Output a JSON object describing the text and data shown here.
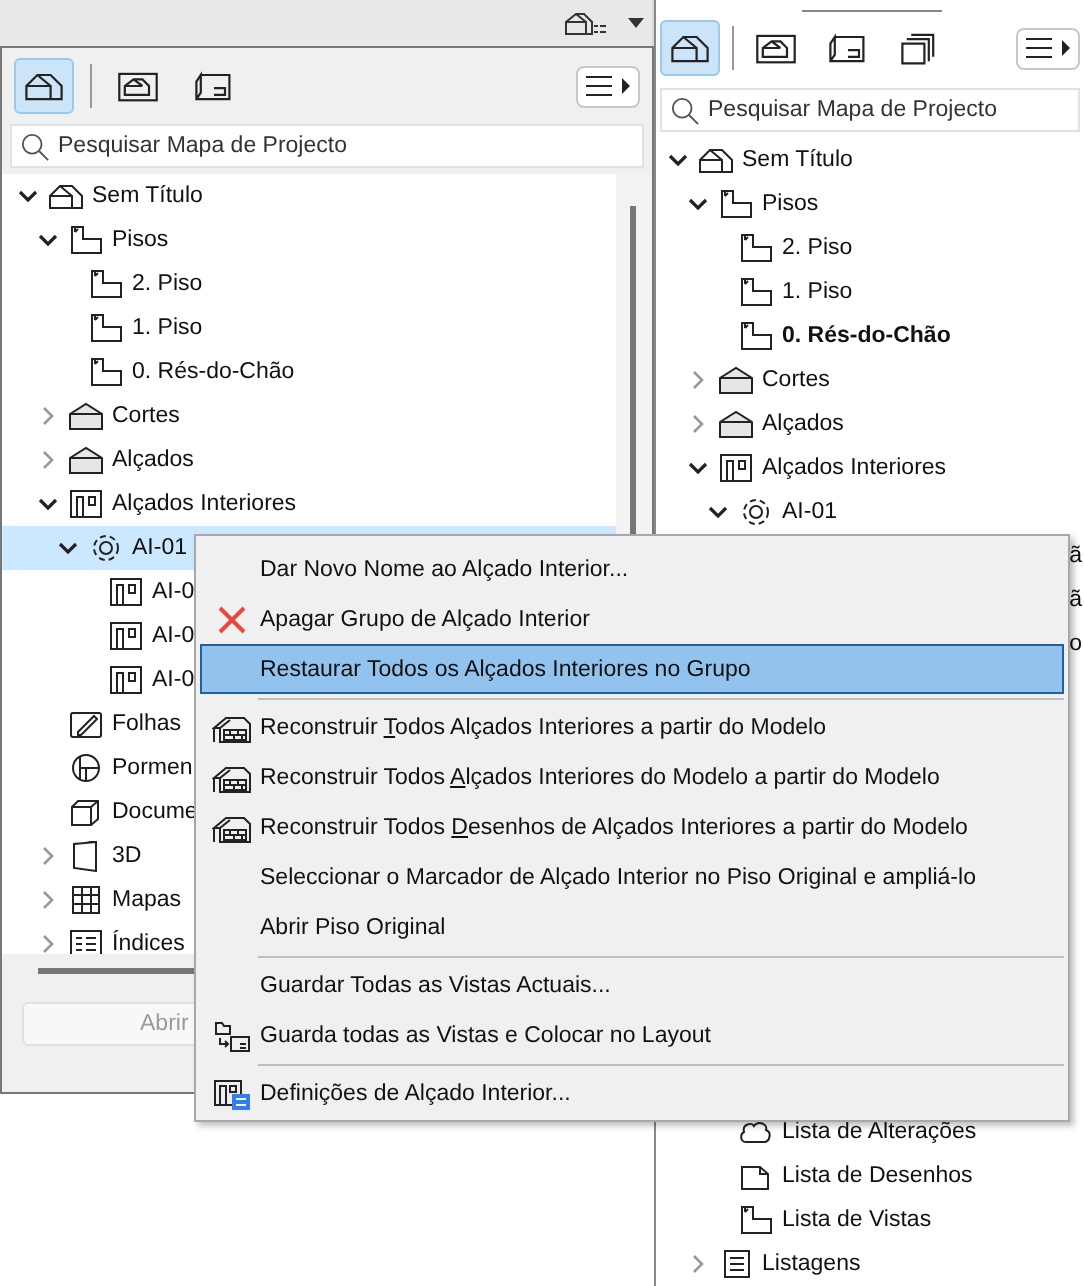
{
  "left_panel": {
    "view_tabs": [
      {
        "selected": true
      },
      {
        "selected": false
      },
      {
        "selected": false
      }
    ],
    "search": {
      "placeholder": "Pesquisar Mapa de Projecto"
    },
    "tree": [
      {
        "label": "Sem Título",
        "kind": "project",
        "expanded": true,
        "selected": false,
        "children": [
          {
            "label": "Pisos",
            "kind": "floor",
            "expanded": true,
            "selected": false,
            "children": [
              {
                "label": "2. Piso",
                "kind": "floor",
                "selected": false,
                "current": false
              },
              {
                "label": "1. Piso",
                "kind": "floor",
                "selected": false,
                "current": false
              },
              {
                "label": "0. Rés-do-Chão",
                "kind": "floor",
                "selected": false,
                "current": false
              }
            ]
          },
          {
            "label": "Cortes",
            "kind": "section",
            "expanded": false,
            "selected": false
          },
          {
            "label": "Alçados",
            "kind": "section",
            "expanded": false,
            "selected": false
          },
          {
            "label": "Alçados Interiores",
            "kind": "interior",
            "expanded": true,
            "selected": false,
            "children": [
              {
                "label": "AI-01",
                "kind": "marker",
                "expanded": true,
                "selected": true,
                "children": [
                  {
                    "label": "AI-0",
                    "kind": "interior",
                    "selected": false
                  },
                  {
                    "label": "AI-0",
                    "kind": "interior",
                    "selected": false
                  },
                  {
                    "label": "AI-0",
                    "kind": "interior",
                    "selected": false
                  }
                ]
              }
            ]
          },
          {
            "label": "Folhas",
            "kind": "worksheet",
            "selected": false
          },
          {
            "label": "Pormen",
            "kind": "detail",
            "selected": false
          },
          {
            "label": "Docume",
            "kind": "document",
            "selected": false
          },
          {
            "label": "3D",
            "kind": "model",
            "expanded": false,
            "selected": false
          },
          {
            "label": "Mapas",
            "kind": "schedule",
            "expanded": false,
            "selected": false
          },
          {
            "label": "Índices",
            "kind": "index",
            "expanded": false,
            "selected": false
          }
        ]
      }
    ],
    "open_button": {
      "label": "Abrir",
      "disabled": true
    }
  },
  "right_panel": {
    "view_tabs": [
      {
        "selected": true
      },
      {
        "selected": false
      },
      {
        "selected": false
      },
      {
        "selected": false
      }
    ],
    "search": {
      "placeholder": "Pesquisar Mapa de Projecto"
    },
    "tree": [
      {
        "label": "Sem Título",
        "kind": "project",
        "expanded": true,
        "selected": false,
        "children": [
          {
            "label": "Pisos",
            "kind": "floor",
            "expanded": true,
            "selected": false,
            "children": [
              {
                "label": "2. Piso",
                "kind": "floor",
                "selected": false,
                "current": false
              },
              {
                "label": "1. Piso",
                "kind": "floor",
                "selected": false,
                "current": false
              },
              {
                "label": "0. Rés-do-Chão",
                "kind": "floor",
                "selected": false,
                "current": true
              }
            ]
          },
          {
            "label": "Cortes",
            "kind": "section",
            "expanded": false,
            "selected": false
          },
          {
            "label": "Alçados",
            "kind": "section",
            "expanded": false,
            "selected": false
          },
          {
            "label": "Alçados Interiores",
            "kind": "interior",
            "expanded": true,
            "selected": false,
            "children": [
              {
                "label": "AI-01",
                "kind": "marker",
                "expanded": true,
                "selected": false,
                "children": [
                  {
                    "kind": "clipped",
                    "label": "ã",
                    "selected": false
                  },
                  {
                    "kind": "clipped",
                    "label": "ã",
                    "selected": false
                  },
                  {
                    "kind": "clipped",
                    "label": "o",
                    "selected": false
                  }
                ]
              }
            ]
          }
        ]
      }
    ],
    "tree_tail": [
      {
        "children": [
          {
            "label": "Lista de Alterações",
            "kind": "changes",
            "selected": false
          },
          {
            "label": "Lista de Desenhos",
            "kind": "drawings",
            "selected": false
          },
          {
            "label": "Lista de Vistas",
            "kind": "views",
            "selected": false
          }
        ]
      },
      {
        "label": "Listagens",
        "kind": "listing",
        "expanded": false,
        "selected": false
      }
    ]
  },
  "context_menu": {
    "items": [
      {
        "kind": "item",
        "label_parts": [
          {
            "text": "Dar Novo Nome ao Alçado Interior...",
            "underline": false
          }
        ],
        "selected": false
      },
      {
        "kind": "delete",
        "label_parts": [
          {
            "text": "Apagar Grupo de Alçado Interior",
            "underline": false
          }
        ],
        "selected": false
      },
      {
        "kind": "item",
        "label_parts": [
          {
            "text": "Restaurar Todos os Alçados Interiores no Grupo",
            "underline": false
          }
        ],
        "selected": true
      },
      {
        "kind": "separator"
      },
      {
        "kind": "rebuild",
        "label_parts": [
          {
            "text": "Reconstruir ",
            "underline": false
          },
          {
            "text": "T",
            "underline": true
          },
          {
            "text": "odos Alçados Interiores a partir do Modelo",
            "underline": false
          }
        ],
        "selected": false
      },
      {
        "kind": "rebuild",
        "label_parts": [
          {
            "text": "Reconstruir Todos ",
            "underline": false
          },
          {
            "text": "A",
            "underline": true
          },
          {
            "text": "lçados Interiores do Modelo a partir do Modelo",
            "underline": false
          }
        ],
        "selected": false
      },
      {
        "kind": "rebuild",
        "label_parts": [
          {
            "text": "Reconstruir Todos ",
            "underline": false
          },
          {
            "text": "D",
            "underline": true
          },
          {
            "text": "esenhos de Alçados Interiores a partir do Modelo",
            "underline": false
          }
        ],
        "selected": false
      },
      {
        "kind": "item",
        "label_parts": [
          {
            "text": "Seleccionar o Marcador de Alçado Interior no Piso Original e ampliá-lo",
            "underline": false
          }
        ],
        "selected": false
      },
      {
        "kind": "item",
        "label_parts": [
          {
            "text": "Abrir Piso Original",
            "underline": false
          }
        ],
        "selected": false
      },
      {
        "kind": "separator"
      },
      {
        "kind": "item",
        "label_parts": [
          {
            "text": "Guardar Todas as Vistas Actuais...",
            "underline": false
          }
        ],
        "selected": false
      },
      {
        "kind": "layout",
        "label_parts": [
          {
            "text": "Guarda todas as Vistas e Colocar no Layout",
            "underline": false
          }
        ],
        "selected": false
      },
      {
        "kind": "separator"
      },
      {
        "kind": "settings",
        "label_parts": [
          {
            "text": "Definições de Alçado Interior...",
            "underline": false
          }
        ],
        "selected": false
      }
    ]
  }
}
